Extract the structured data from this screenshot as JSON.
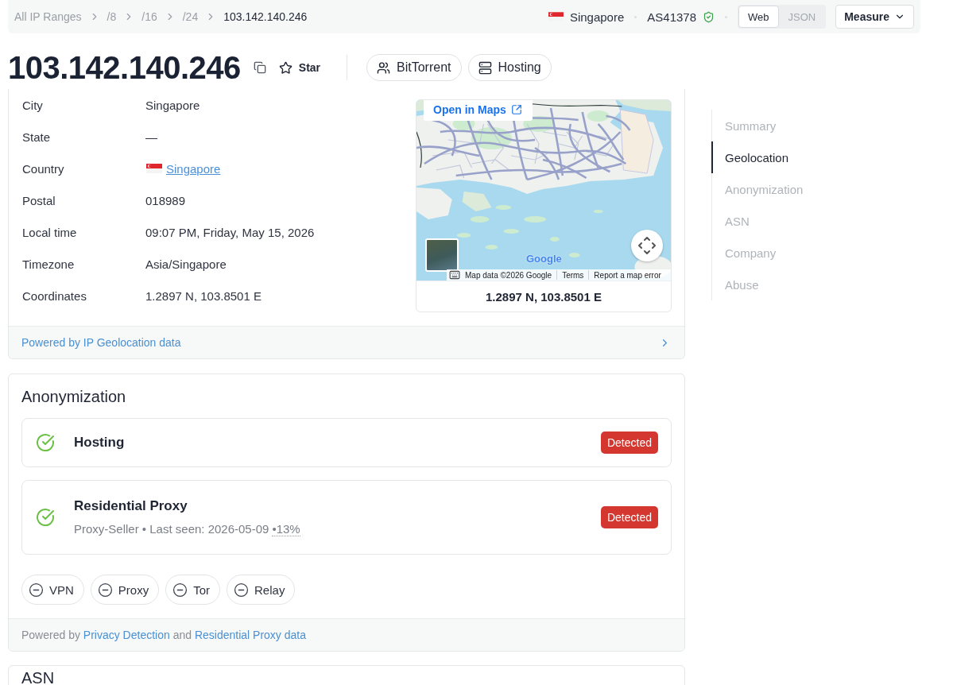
{
  "breadcrumbs": [
    {
      "label": "All IP Ranges",
      "current": false
    },
    {
      "label": "/8",
      "current": false
    },
    {
      "label": "/16",
      "current": false
    },
    {
      "label": "/24",
      "current": false
    },
    {
      "label": "103.142.140.246",
      "current": true
    }
  ],
  "top_bar": {
    "country": "Singapore",
    "asn": "AS41378",
    "asn_verified": true,
    "view_toggle": [
      {
        "label": "Web",
        "selected": true
      },
      {
        "label": "JSON",
        "selected": false
      }
    ],
    "measure_button": "Measure"
  },
  "header": {
    "ip": "103.142.140.246",
    "star_label": "Star",
    "starred": false,
    "tags": [
      {
        "label": "BitTorrent",
        "kind": "bittorrent"
      },
      {
        "label": "Hosting",
        "kind": "hosting"
      }
    ]
  },
  "geolocation": {
    "rows": [
      {
        "label": "City",
        "value": "Singapore",
        "kind": "text"
      },
      {
        "label": "State",
        "value": "—",
        "kind": "text"
      },
      {
        "label": "Country",
        "value": "Singapore",
        "kind": "country"
      },
      {
        "label": "Postal",
        "value": "018989",
        "kind": "text"
      },
      {
        "label": "Local time",
        "value": "09:07 PM, Friday, May 15, 2026",
        "kind": "text"
      },
      {
        "label": "Timezone",
        "value": "Asia/Singapore",
        "kind": "text"
      },
      {
        "label": "Coordinates",
        "value": "1.2897 N, 103.8501 E",
        "kind": "text"
      }
    ],
    "map": {
      "open_link": "Open in Maps",
      "logo": "Google",
      "credit": "Map data ©2026 Google",
      "links": [
        "Terms",
        "Report a map error"
      ],
      "caption": "1.2897 N, 103.8501 E"
    },
    "footer": "Powered by IP Geolocation data"
  },
  "anonymization": {
    "title": "Anonymization",
    "detections": [
      {
        "name": "Hosting",
        "detected": true,
        "badge": "Detected"
      },
      {
        "name": "Residential Proxy",
        "detected": true,
        "badge": "Detected",
        "details": "Proxy-Seller • Last seen: 2026-05-09",
        "share": "•13%"
      }
    ],
    "flags": [
      {
        "label": "VPN",
        "detected": false
      },
      {
        "label": "Proxy",
        "detected": false
      },
      {
        "label": "Tor",
        "detected": false
      },
      {
        "label": "Relay",
        "detected": false
      }
    ],
    "footer": [
      {
        "text": "Powered by",
        "kind": "text"
      },
      {
        "text": "Privacy Detection",
        "kind": "link"
      },
      {
        "text": "and",
        "kind": "text"
      },
      {
        "text": "Residential Proxy data",
        "kind": "link"
      }
    ]
  },
  "asn": {
    "title": "ASN"
  },
  "section_nav": [
    {
      "label": "Summary",
      "selected": false
    },
    {
      "label": "Geolocation",
      "selected": true
    },
    {
      "label": "Anonymization",
      "selected": false
    },
    {
      "label": "ASN",
      "selected": false
    },
    {
      "label": "Company",
      "selected": false
    },
    {
      "label": "Abuse",
      "selected": false
    }
  ]
}
